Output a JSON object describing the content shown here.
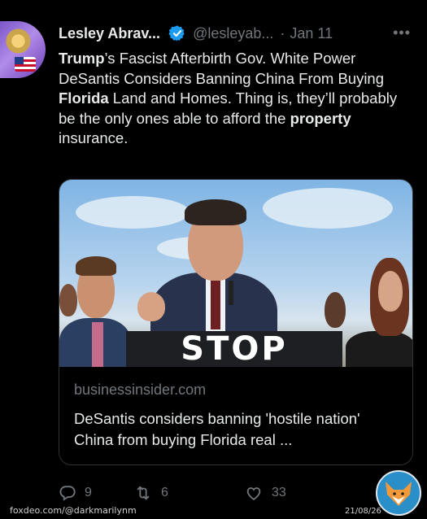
{
  "tweet": {
    "display_name": "Lesley Abrav...",
    "handle": "@lesleyab...",
    "separator": "·",
    "date": "Jan 11",
    "more_glyph": "•••",
    "text_segments": [
      {
        "t": "Trump",
        "bold": true
      },
      {
        "t": "’s Fascist Afterbirth Gov. White Power DeSantis Considers Banning China From Buying ",
        "bold": false
      },
      {
        "t": "Florida",
        "bold": true
      },
      {
        "t": " Land and Homes. Thing is, they’ll probably be the only ones able to afford the ",
        "bold": false
      },
      {
        "t": "property",
        "bold": true
      },
      {
        "t": " insurance.",
        "bold": false
      }
    ]
  },
  "card": {
    "sign_text": "STOP",
    "domain": "businessinsider.com",
    "title": "DeSantis considers banning 'hostile nation' China from buying Florida real ..."
  },
  "actions": {
    "replies": "9",
    "retweets": "6",
    "likes": "33"
  },
  "watermark": {
    "text": "foxdeo.com/@darkmarilynm",
    "date": "21/08/26"
  },
  "icons": {
    "verified": "verified-badge-icon",
    "more": "more-options-icon",
    "reply": "reply-icon",
    "retweet": "retweet-icon",
    "like": "like-icon"
  },
  "colors": {
    "background": "#000000",
    "text": "#e7e9ea",
    "muted": "#71767b",
    "verified": "#1d9bf0",
    "border": "#2f3336"
  }
}
